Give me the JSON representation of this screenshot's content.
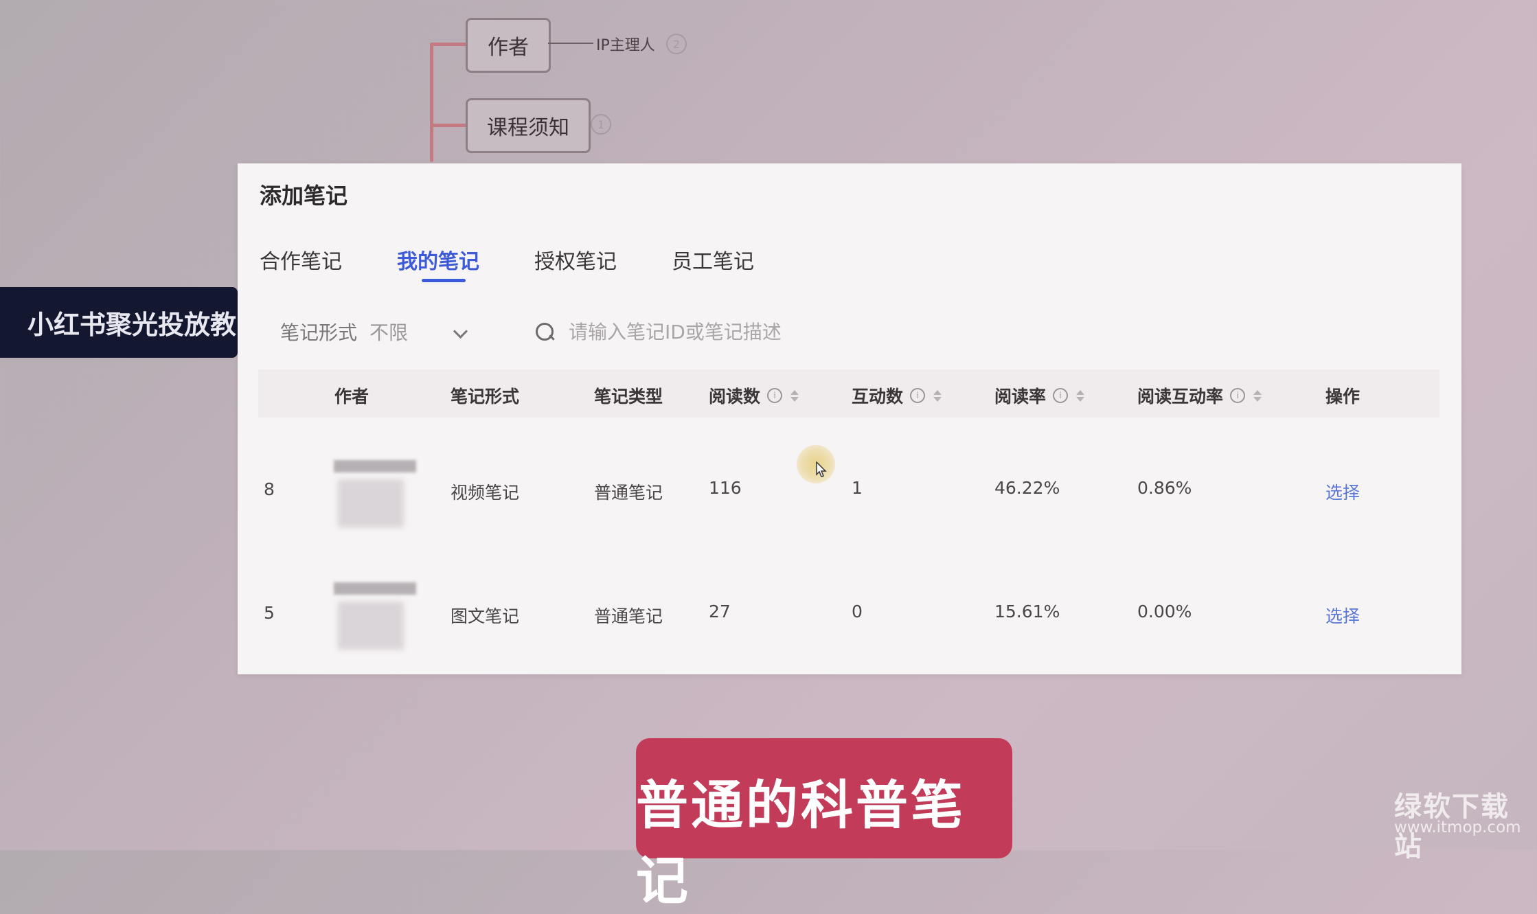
{
  "mindmap": {
    "node_author": "作者",
    "node_course": "课程须知",
    "author_child": "IP主理人",
    "author_badge": "2",
    "course_badge": "1"
  },
  "banner": {
    "text": "小红书聚光投放教"
  },
  "dialog": {
    "title": "添加笔记",
    "tabs": [
      {
        "label": "合作笔记",
        "active": false
      },
      {
        "label": "我的笔记",
        "active": true
      },
      {
        "label": "授权笔记",
        "active": false
      },
      {
        "label": "员工笔记",
        "active": false
      }
    ],
    "filter": {
      "label": "笔记形式",
      "value": "不限"
    },
    "search": {
      "placeholder": "请输入笔记ID或笔记描述"
    },
    "table": {
      "headers": {
        "author": "作者",
        "note_form": "笔记形式",
        "note_type": "笔记类型",
        "reads": "阅读数",
        "interactions": "互动数",
        "read_rate": "阅读率",
        "read_interact_rate": "阅读互动率",
        "action": "操作"
      },
      "rows": [
        {
          "index": "8",
          "note_form": "视频笔记",
          "note_type": "普通笔记",
          "reads": "116",
          "interactions": "1",
          "read_rate": "46.22%",
          "read_interact_rate": "0.86%",
          "action": "选择"
        },
        {
          "index": "5",
          "note_form": "图文笔记",
          "note_type": "普通笔记",
          "reads": "27",
          "interactions": "0",
          "read_rate": "15.61%",
          "read_interact_rate": "0.00%",
          "action": "选择"
        }
      ]
    }
  },
  "caption": "普通的科普笔记",
  "watermark": {
    "name": "绿软下载站",
    "url": "www.itmop.com"
  },
  "colors": {
    "accent": "#3d5bd9",
    "caption_bg": "#c23c5a",
    "banner_bg": "#141730"
  }
}
